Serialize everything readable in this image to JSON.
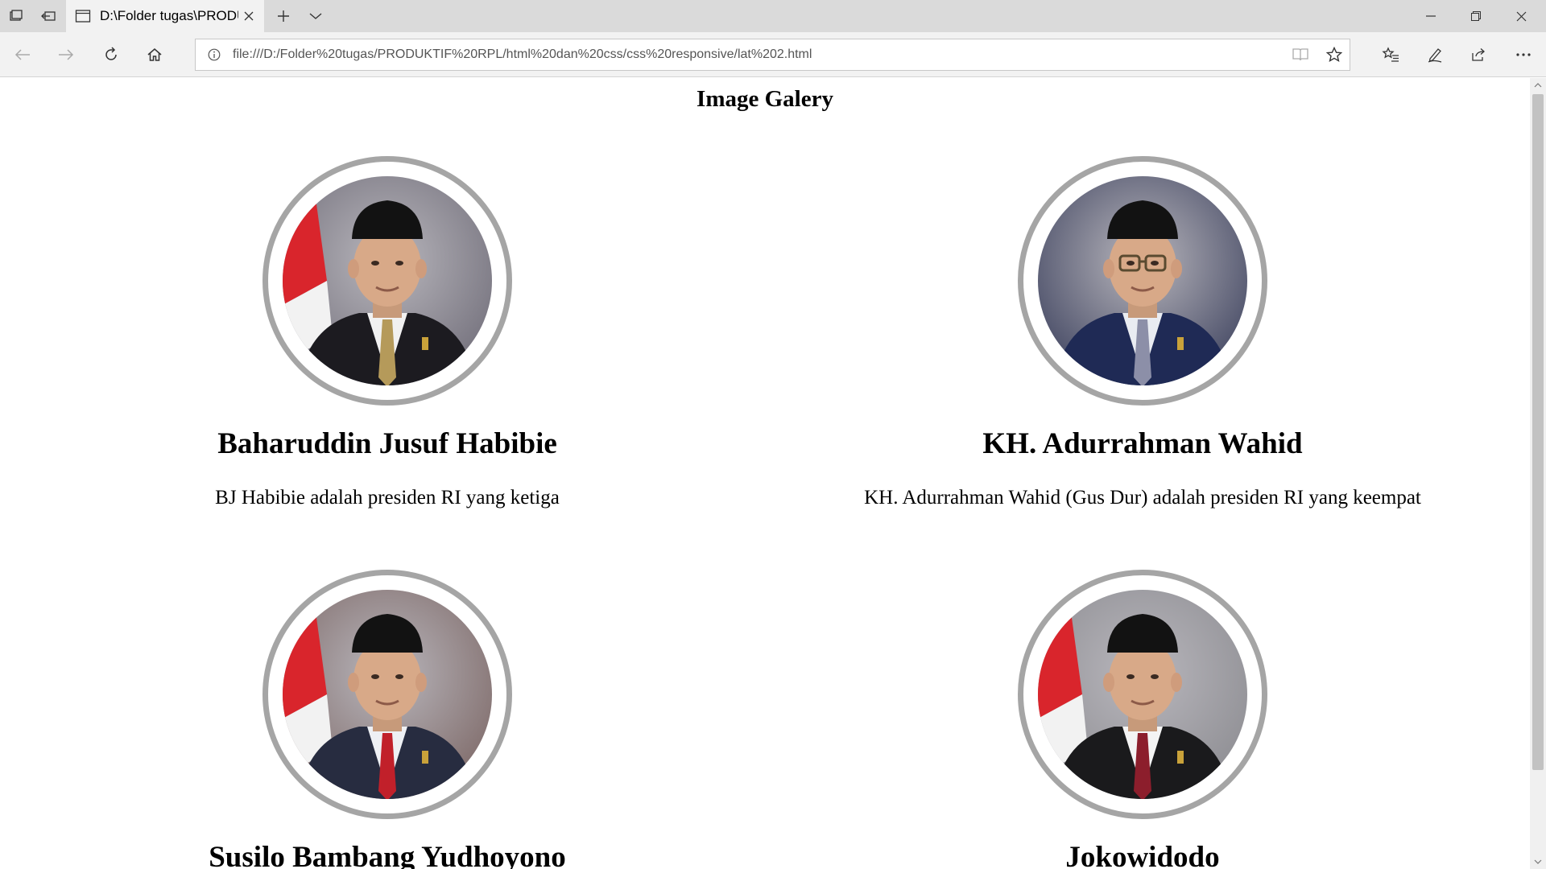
{
  "browser": {
    "tab_title": "D:\\Folder tugas\\PRODUKTIF RPL",
    "address_url": "file:///D:/Folder%20tugas/PRODUKTIF%20RPL/html%20dan%20css/css%20responsive/lat%202.html"
  },
  "page": {
    "title": "Image Galery"
  },
  "gallery": [
    {
      "name": "Baharuddin Jusuf Habibie",
      "description": "BJ Habibie adalah presiden RI yang ketiga",
      "colors": {
        "bg": "#6d6a76",
        "suit": "#1c1b20",
        "shirt": "#f1f1f1",
        "tie": "#b59a5a",
        "flag": true,
        "glasses": false
      }
    },
    {
      "name": "KH. Adurrahman Wahid",
      "description": "KH. Adurrahman Wahid (Gus Dur) adalah presiden RI yang keempat",
      "colors": {
        "bg": "#3a3f5c",
        "suit": "#1f2a55",
        "shirt": "#e9ecf2",
        "tie": "#8c8fa8",
        "flag": false,
        "glasses": true
      }
    },
    {
      "name": "Susilo Bambang Yudhoyono",
      "description": "",
      "colors": {
        "bg": "#7a6462",
        "suit": "#272c40",
        "shirt": "#eef0f4",
        "tie": "#c1202a",
        "flag": true,
        "glasses": false
      }
    },
    {
      "name": "Jokowidodo",
      "description": "",
      "colors": {
        "bg": "#8a8a8f",
        "suit": "#1a1a1c",
        "shirt": "#f4f4f4",
        "tie": "#8c1e2c",
        "flag": true,
        "glasses": false
      }
    }
  ]
}
